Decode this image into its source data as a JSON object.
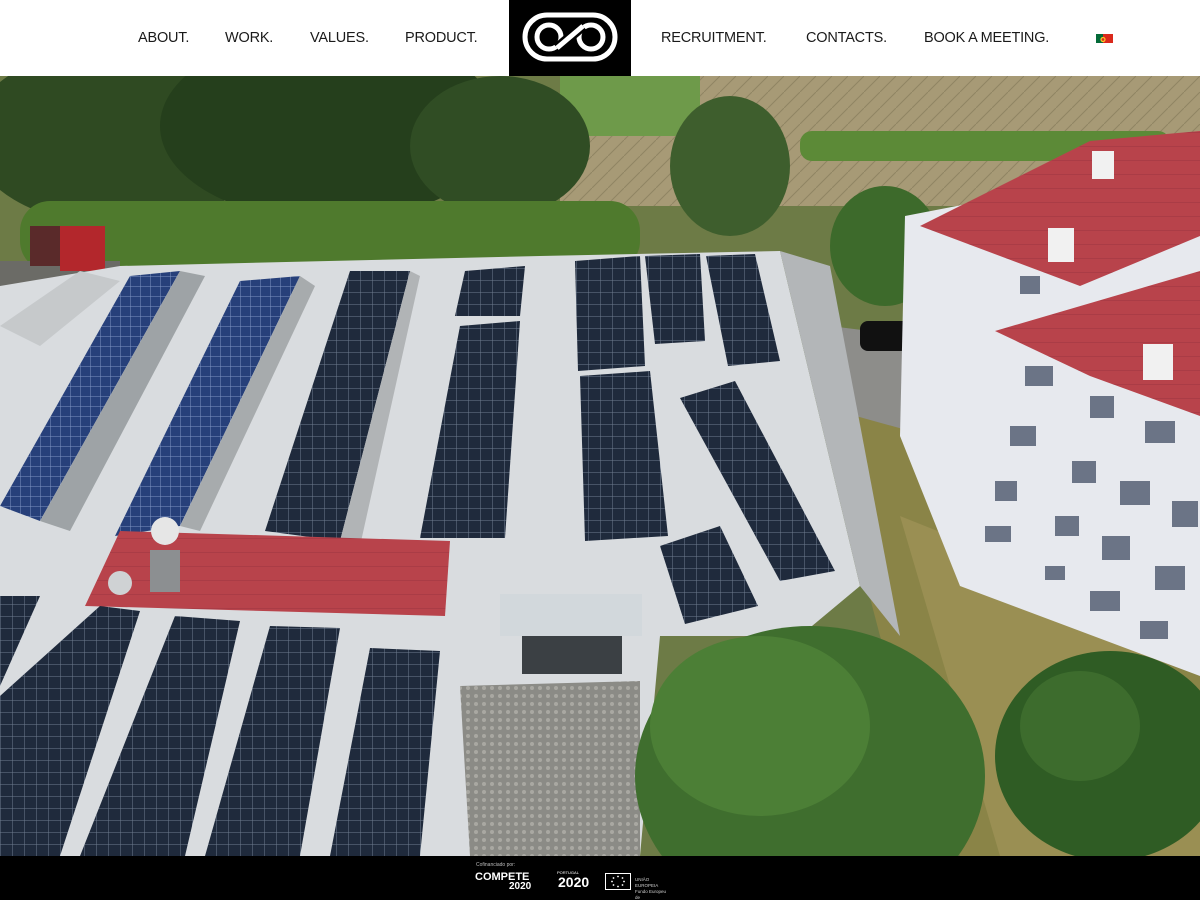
{
  "nav": {
    "left": [
      "ABOUT.",
      "WORK.",
      "VALUES.",
      "PRODUCT."
    ],
    "right": [
      "RECRUITMENT.",
      "CONTACTS.",
      "BOOK A MEETING."
    ]
  },
  "brand": {
    "logo_icon": "interlocking-loops-logo",
    "bg": "#000000",
    "fg": "#ffffff"
  },
  "language": {
    "icon": "portugal-flag-icon",
    "colors": [
      "#046a38",
      "#da291c"
    ]
  },
  "hero": {
    "image": "aerial-factory-solar-roof-photo"
  },
  "footer": {
    "cofinanced_label": "Cofinanciado por:",
    "compete": {
      "word": "COMPETE",
      "year": "2020"
    },
    "portugal2020": {
      "label": "PORTUGAL",
      "year": "2020"
    },
    "eu": {
      "icon": "eu-flag-icon",
      "caption": "UNIÃO EUROPEIA Fundo Europeu de Desenvolvimento Regional"
    }
  },
  "colors": {
    "header_bg": "#ffffff",
    "nav_text": "#1a1a1a",
    "footer_bg": "#000000",
    "roof_red": "#b8434b",
    "panel": "#1f2a3c"
  }
}
